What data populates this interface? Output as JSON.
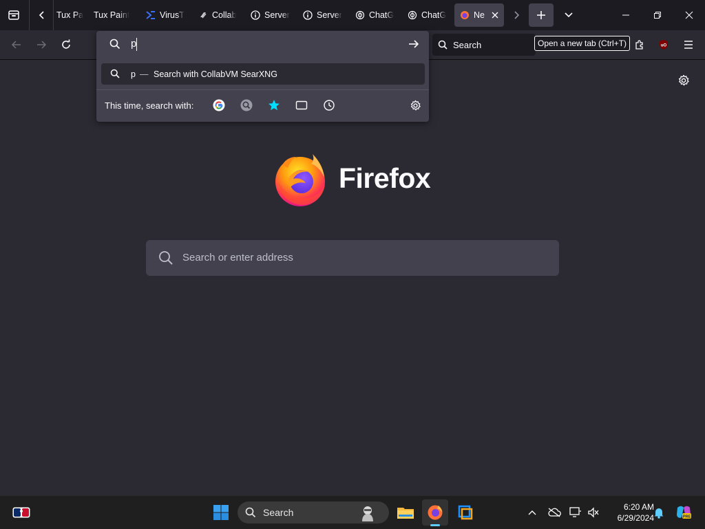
{
  "browser": {
    "tabs": [
      {
        "label": "Tux Pa",
        "icon": "tuxpaint-icon"
      },
      {
        "label": "Tux Paint",
        "icon": "tuxpaint-icon"
      },
      {
        "label": "VirusT",
        "icon": "virustotal-icon"
      },
      {
        "label": "Collab",
        "icon": "collabvm-icon"
      },
      {
        "label": "Server",
        "icon": "info-icon"
      },
      {
        "label": "Server",
        "icon": "info-icon"
      },
      {
        "label": "ChatG",
        "icon": "chatgpt-icon"
      },
      {
        "label": "ChatG",
        "icon": "chatgpt-icon"
      },
      {
        "label": "Ne",
        "icon": "firefox-icon",
        "active": true
      }
    ],
    "new_tab_tooltip": "Open a new tab (Ctrl+T)",
    "search_bar_label": "Search",
    "url_input_value": "p",
    "suggestion": {
      "query": "p",
      "separator": "—",
      "action": "Search with CollabVM SearXNG"
    },
    "one_off_label": "This time, search with:",
    "one_off_engines": [
      "google-icon",
      "searxng-icon",
      "bookmarks-icon",
      "tabs-icon",
      "history-icon"
    ]
  },
  "newtab": {
    "brand": "Firefox",
    "search_placeholder": "Search or enter address"
  },
  "taskbar": {
    "search_label": "Search",
    "time": "6:20 AM",
    "date": "6/29/2024"
  },
  "colors": {
    "accent": "#00ddff",
    "page_bg": "#2b2a33",
    "panel_bg": "#42414d",
    "strip_bg": "#1c1b22"
  }
}
